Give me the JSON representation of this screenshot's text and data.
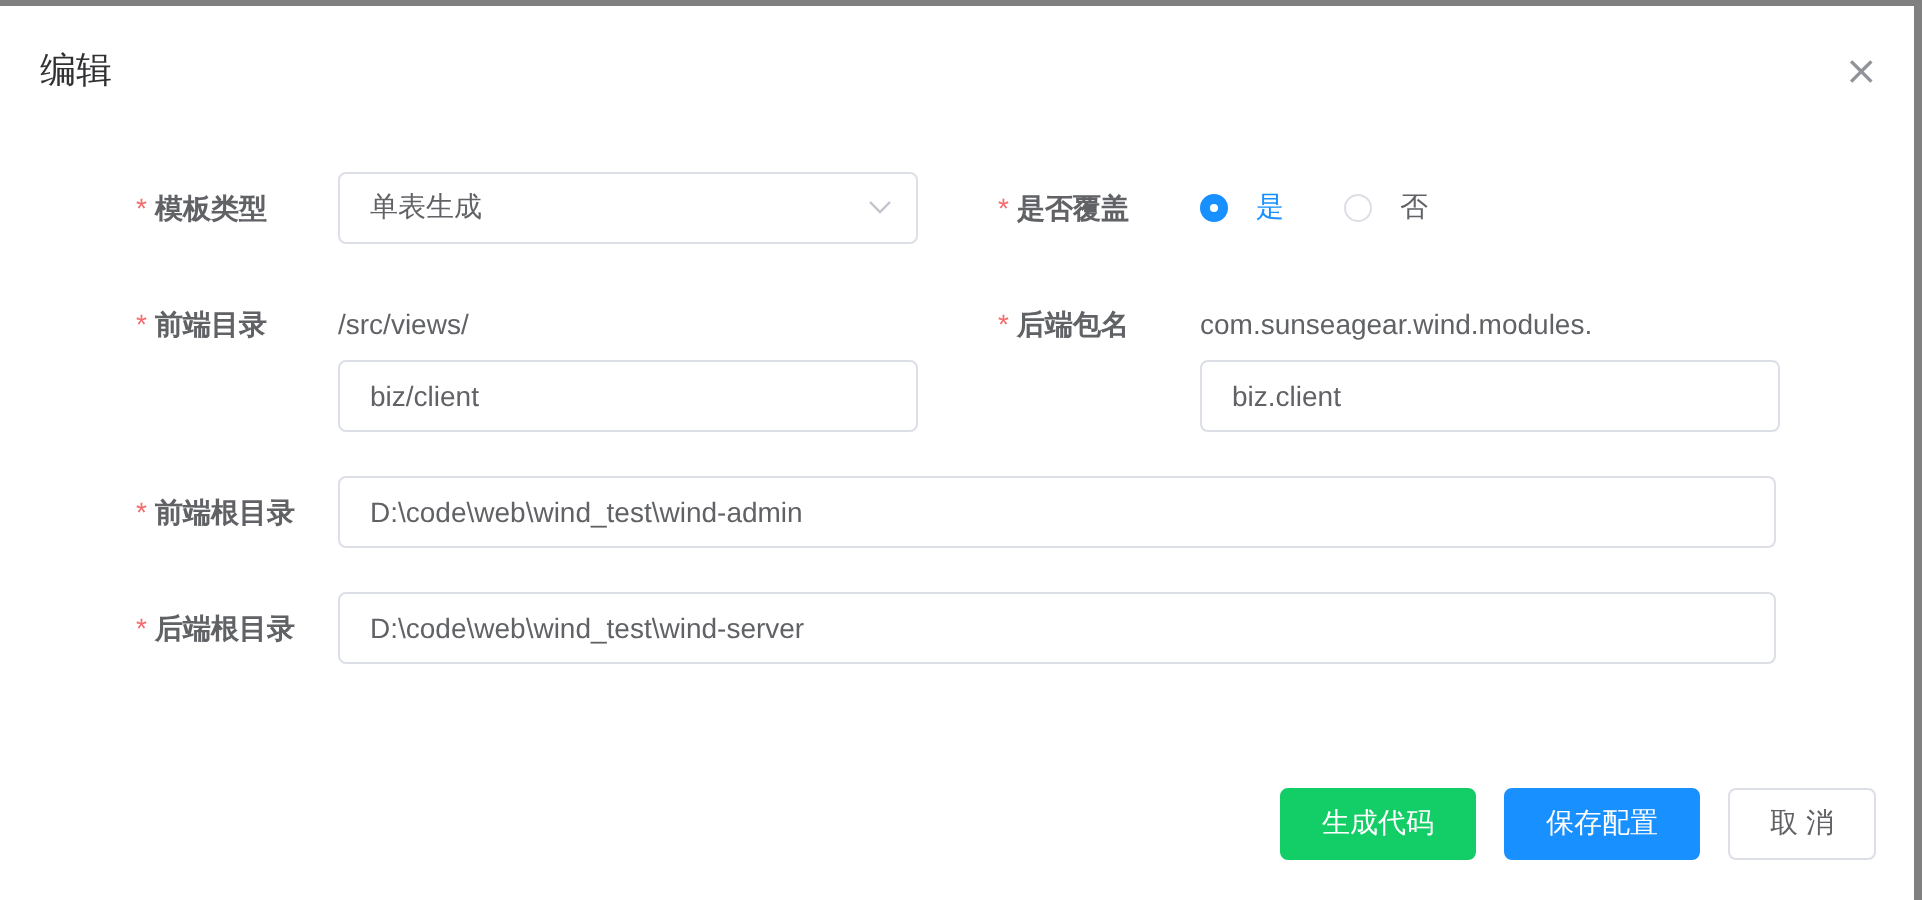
{
  "dialog": {
    "title": "编辑",
    "close": "×"
  },
  "rows": [
    [
      {
        "kind": "select",
        "marker": "*",
        "label": "模板类型",
        "value": "单表生成"
      },
      {
        "kind": "radio",
        "marker": "*",
        "label": "是否覆盖",
        "options": [
          {
            "label": "是",
            "selected": true
          },
          {
            "label": "否",
            "selected": false
          }
        ]
      }
    ],
    [
      {
        "kind": "prefixed",
        "marker": "*",
        "label": "前端目录",
        "prefix": "/src/views/",
        "value": "biz/client"
      },
      {
        "kind": "prefixed",
        "marker": "*",
        "label": "后端包名",
        "prefix": "com.sunseagear.wind.modules.",
        "value": "biz.client"
      }
    ],
    [
      {
        "kind": "input",
        "marker": "*",
        "label": "前端根目录",
        "value": "D:\\code\\web\\wind_test\\wind-admin"
      }
    ],
    [
      {
        "kind": "input",
        "marker": "*",
        "label": "后端根目录",
        "value": "D:\\code\\web\\wind_test\\wind-server"
      }
    ]
  ],
  "buttons": [
    {
      "kind": "success",
      "label": "生成代码"
    },
    {
      "kind": "primary",
      "label": "保存配置"
    },
    {
      "kind": "default",
      "label": "取 消"
    }
  ]
}
